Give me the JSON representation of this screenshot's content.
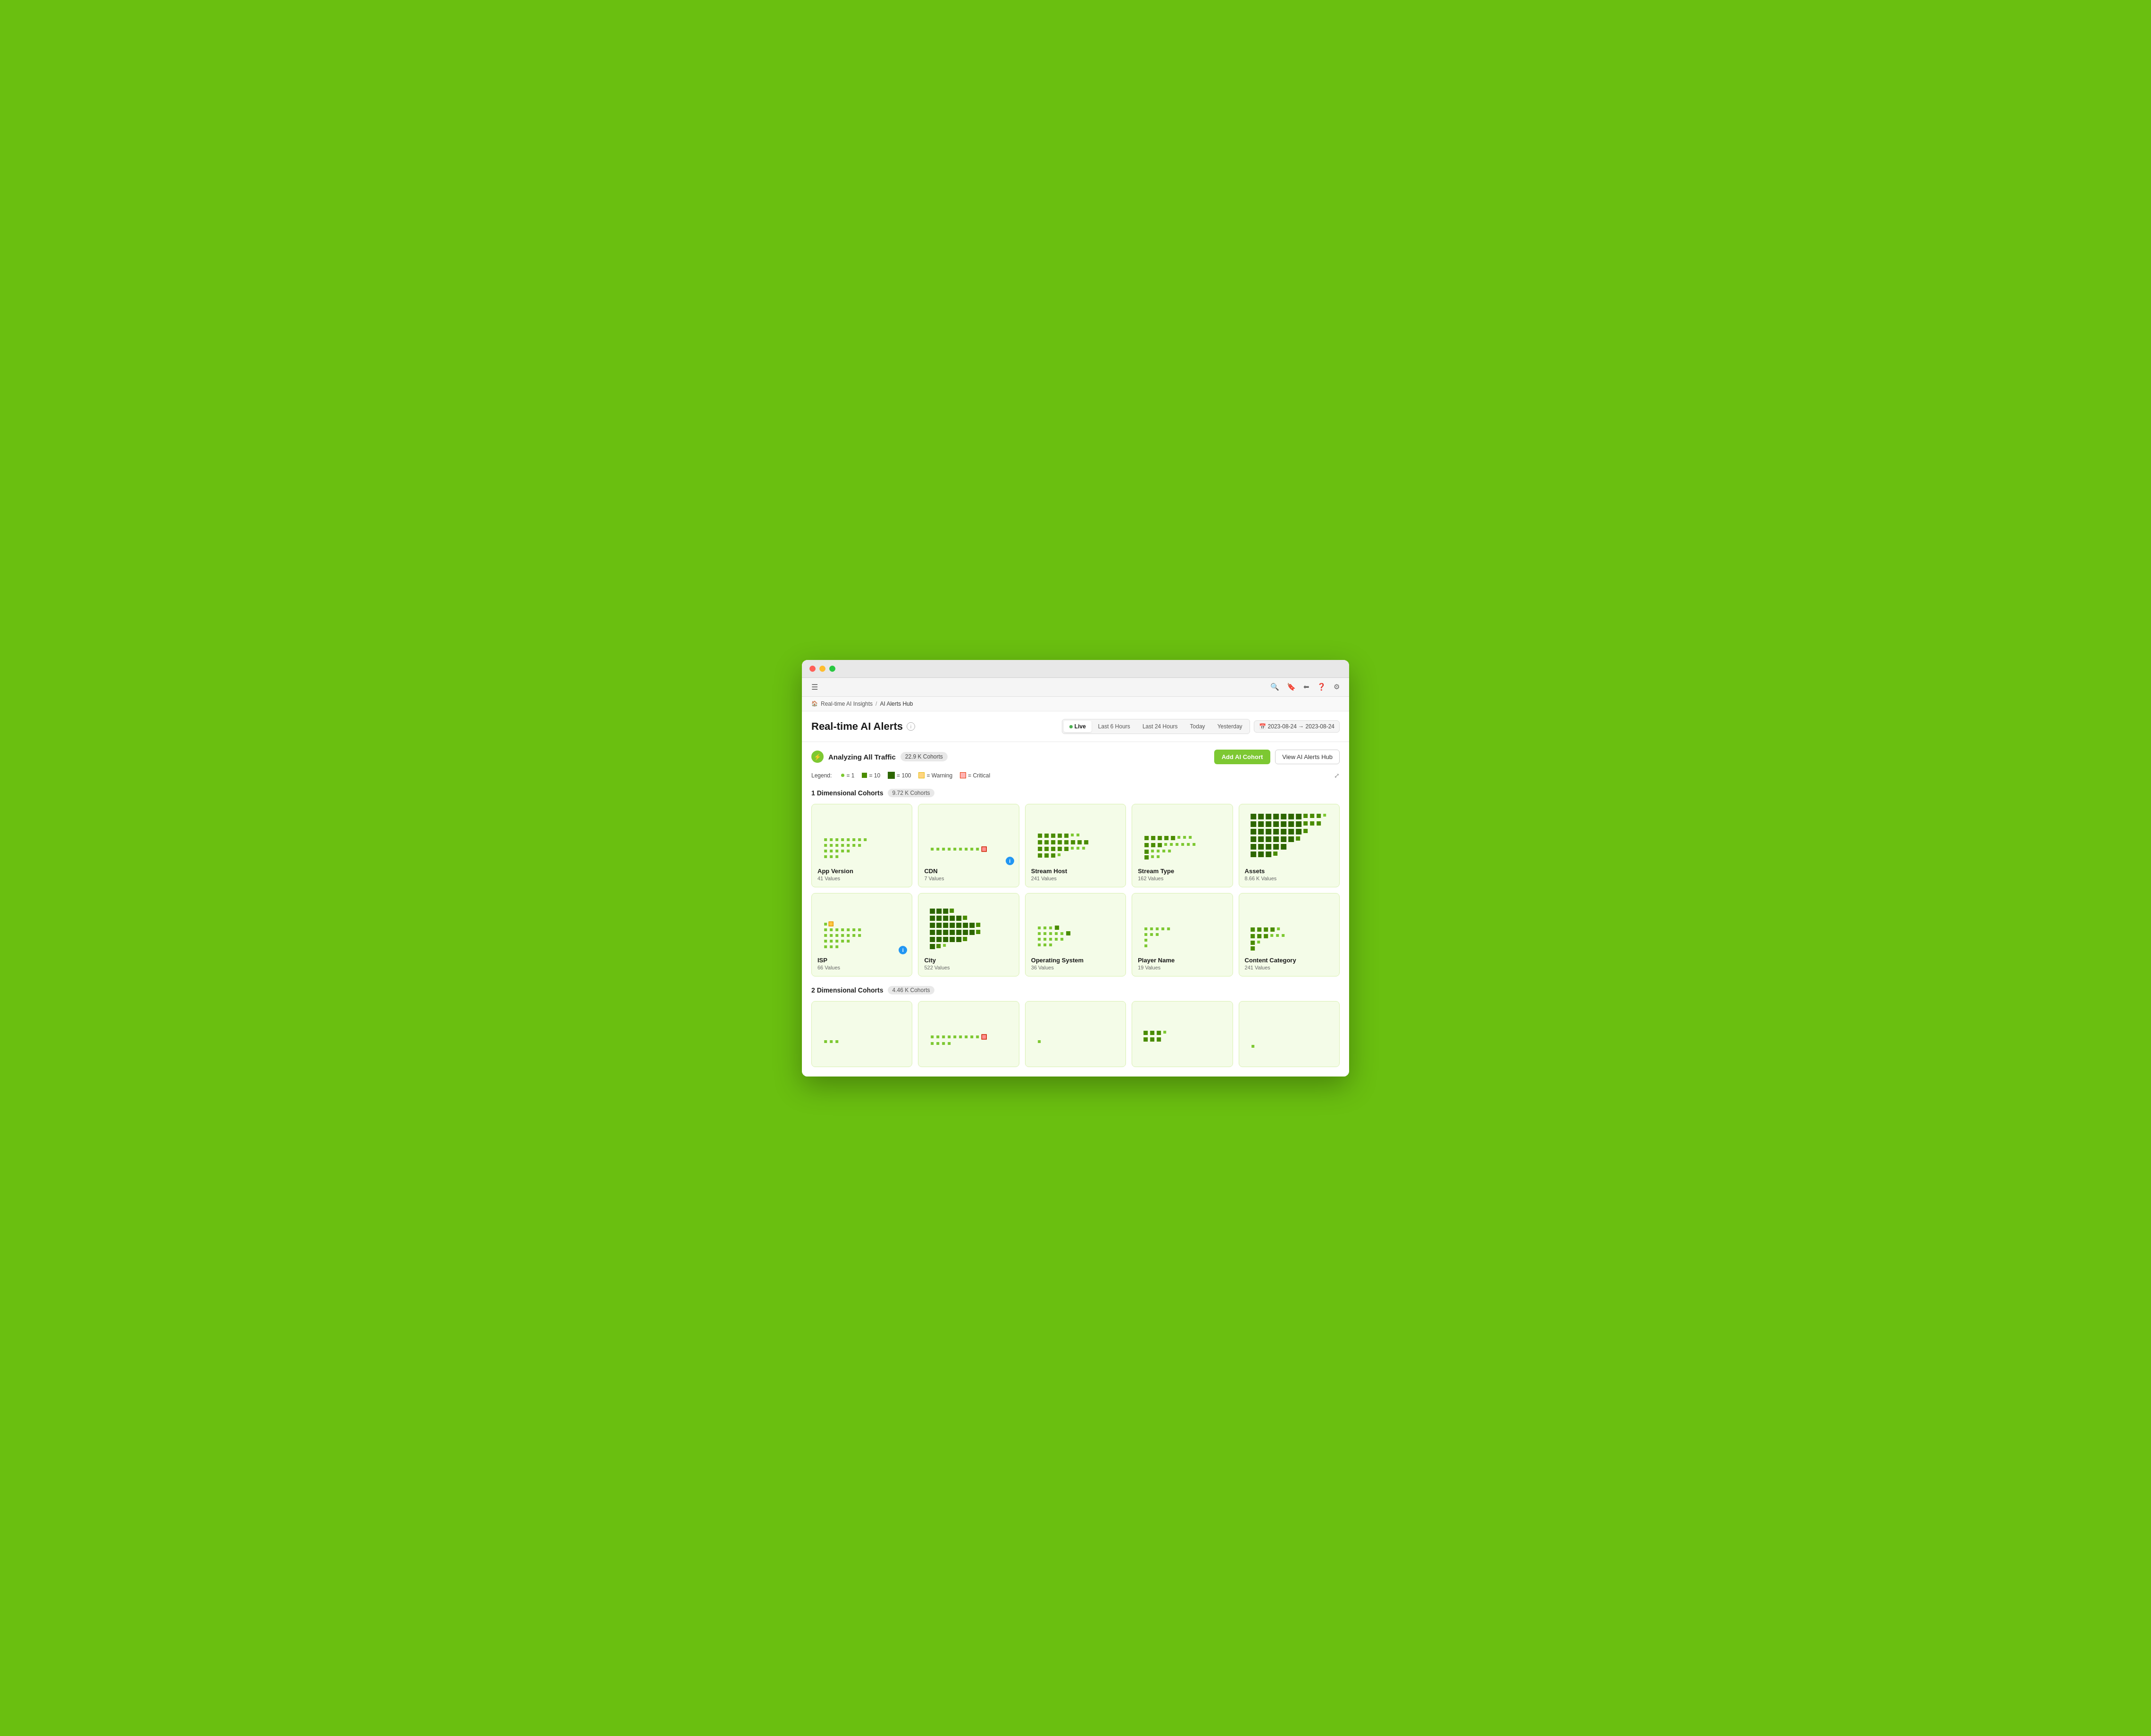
{
  "window": {
    "title": "Real-time AI Alerts"
  },
  "breadcrumb": {
    "home": "Real-time AI Insights",
    "current": "AI Alerts Hub"
  },
  "header": {
    "title": "Real-time AI Alerts",
    "info_icon": "ⓘ"
  },
  "time_controls": {
    "live_label": "Live",
    "options": [
      "Last 6 Hours",
      "Last 24 Hours",
      "Today",
      "Yesterday"
    ],
    "date_range": "2023-08-24 → 2023-08-24",
    "active": "Live"
  },
  "analyzing": {
    "icon": "⚡",
    "label": "Analyzing All Traffic",
    "cohorts": "22.9 K Cohorts"
  },
  "actions": {
    "add_cohort": "Add AI Cohort",
    "view_hub": "View AI Alerts Hub"
  },
  "legend": {
    "label": "Legend:",
    "items": [
      {
        "label": "= 1",
        "type": "dot-sm"
      },
      {
        "label": "= 10",
        "type": "dot-md"
      },
      {
        "label": "= 100",
        "type": "dot-lg"
      },
      {
        "label": "= Warning",
        "type": "warning"
      },
      {
        "label": "= Critical",
        "type": "critical"
      }
    ]
  },
  "dim1": {
    "title": "1 Dimensional Cohorts",
    "count": "9.72 K Cohorts",
    "cards": [
      {
        "name": "App Version",
        "values": "41 Values",
        "density": "sparse",
        "has_warning": false,
        "has_info": false
      },
      {
        "name": "CDN",
        "values": "7 Values",
        "density": "sparse",
        "has_warning": false,
        "has_critical": true,
        "has_info": true
      },
      {
        "name": "Stream Host",
        "values": "241 Values",
        "density": "medium",
        "has_warning": false,
        "has_info": false
      },
      {
        "name": "Stream Type",
        "values": "162 Values",
        "density": "medium",
        "has_warning": false,
        "has_info": false
      },
      {
        "name": "Assets",
        "values": "8.66 K Values",
        "density": "dense",
        "has_warning": false,
        "has_info": false
      },
      {
        "name": "ISP",
        "values": "66 Values",
        "density": "sparse",
        "has_warning": true,
        "has_info": true
      },
      {
        "name": "City",
        "values": "522 Values",
        "density": "medium-dense",
        "has_warning": false,
        "has_info": false
      },
      {
        "name": "Operating System",
        "values": "36 Values",
        "density": "sparse-medium",
        "has_warning": false,
        "has_info": false
      },
      {
        "name": "Player Name",
        "values": "19 Values",
        "density": "sparse",
        "has_warning": false,
        "has_info": false
      },
      {
        "name": "Content Category",
        "values": "241 Values",
        "density": "medium",
        "has_warning": false,
        "has_info": false
      }
    ]
  },
  "dim2": {
    "title": "2 Dimensional Cohorts",
    "count": "4.46 K Cohorts",
    "cards": [
      {
        "name": "card-2d-1",
        "density": "sparse",
        "has_critical": false
      },
      {
        "name": "card-2d-2",
        "density": "sparse",
        "has_critical": true
      },
      {
        "name": "card-2d-3",
        "density": "sparse",
        "has_critical": false
      },
      {
        "name": "card-2d-4",
        "density": "medium",
        "has_critical": false
      },
      {
        "name": "card-2d-5",
        "density": "sparse",
        "has_critical": false
      }
    ]
  }
}
